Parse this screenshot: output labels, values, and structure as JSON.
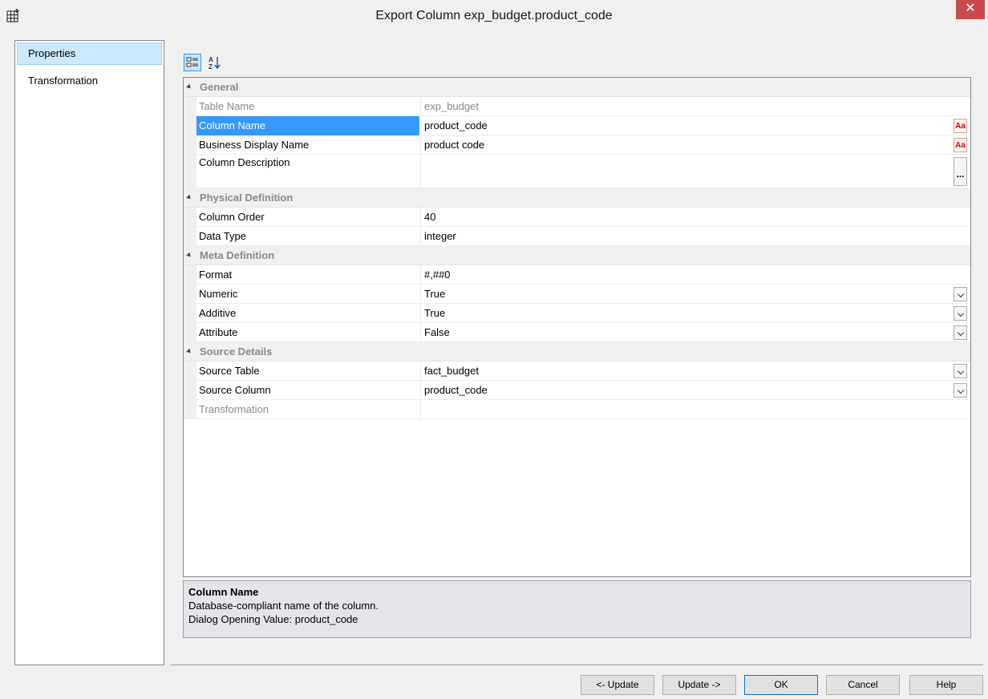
{
  "window": {
    "title": "Export Column exp_budget.product_code",
    "close_glyph": "✕"
  },
  "nav": {
    "items": [
      {
        "label": "Properties"
      },
      {
        "label": "Transformation"
      }
    ]
  },
  "toolbar": {
    "categorized_icon": "categorized-icon",
    "alphabetical_icon": "sort-az-icon"
  },
  "grid": {
    "general": {
      "label": "General",
      "table_name": {
        "name": "Table Name",
        "value": "exp_budget"
      },
      "column_name": {
        "name": "Column Name",
        "value": "product_code"
      },
      "business_display_name": {
        "name": "Business Display Name",
        "value": "product code"
      },
      "column_description": {
        "name": "Column Description",
        "value": ""
      }
    },
    "physical": {
      "label": "Physical Definition",
      "column_order": {
        "name": "Column Order",
        "value": "40"
      },
      "data_type": {
        "name": "Data Type",
        "value": "integer"
      }
    },
    "meta": {
      "label": "Meta Definition",
      "format": {
        "name": "Format",
        "value": "#,##0"
      },
      "numeric": {
        "name": "Numeric",
        "value": "True"
      },
      "additive": {
        "name": "Additive",
        "value": "True"
      },
      "attribute": {
        "name": "Attribute",
        "value": "False"
      }
    },
    "source": {
      "label": "Source Details",
      "source_table": {
        "name": "Source Table",
        "value": "fact_budget"
      },
      "source_column": {
        "name": "Source Column",
        "value": "product_code"
      },
      "transformation": {
        "name": "Transformation",
        "value": ""
      }
    },
    "font_btn_glyph": "Aa",
    "ellipsis_glyph": "..."
  },
  "help": {
    "title": "Column Name",
    "line1": "Database-compliant name of the column.",
    "line2": "Dialog Opening Value: product_code"
  },
  "buttons": {
    "prev_update": "<- Update",
    "next_update": "Update ->",
    "ok": "OK",
    "cancel": "Cancel",
    "help": "Help"
  }
}
